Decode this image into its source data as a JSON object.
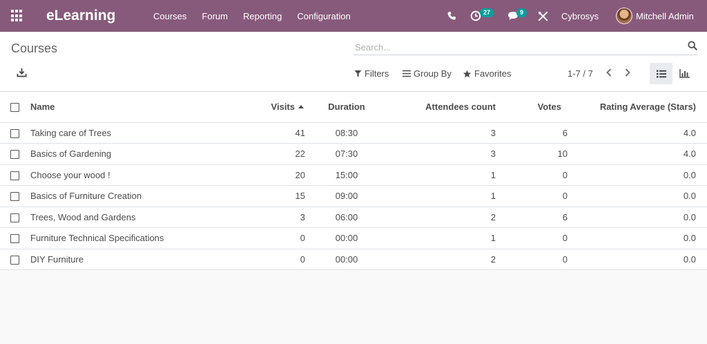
{
  "navbar": {
    "brand": "eLearning",
    "menu": [
      "Courses",
      "Forum",
      "Reporting",
      "Configuration"
    ],
    "activity_count": "27",
    "message_count": "9",
    "company": "Cybrosys",
    "user": "Mitchell Admin",
    "colors": {
      "bar": "#875a7b",
      "badge": "#00a09d"
    }
  },
  "control_panel": {
    "breadcrumb": "Courses",
    "search_placeholder": "Search...",
    "filters_label": "Filters",
    "groupby_label": "Group By",
    "favorites_label": "Favorites",
    "pager": "1-7 / 7",
    "active_view": "list"
  },
  "table": {
    "columns": [
      "Name",
      "Visits",
      "Duration",
      "Attendees count",
      "Votes",
      "Rating Average (Stars)"
    ],
    "sorted_by": "Visits",
    "rows": [
      {
        "name": "Taking care of Trees",
        "visits": "41",
        "duration": "08:30",
        "attendees": "3",
        "votes": "6",
        "rating": "4.0"
      },
      {
        "name": "Basics of Gardening",
        "visits": "22",
        "duration": "07:30",
        "attendees": "3",
        "votes": "10",
        "rating": "4.0"
      },
      {
        "name": "Choose your wood !",
        "visits": "20",
        "duration": "15:00",
        "attendees": "1",
        "votes": "0",
        "rating": "0.0"
      },
      {
        "name": "Basics of Furniture Creation",
        "visits": "15",
        "duration": "09:00",
        "attendees": "1",
        "votes": "0",
        "rating": "0.0"
      },
      {
        "name": "Trees, Wood and Gardens",
        "visits": "3",
        "duration": "06:00",
        "attendees": "2",
        "votes": "6",
        "rating": "0.0"
      },
      {
        "name": "Furniture Technical Specifications",
        "visits": "0",
        "duration": "00:00",
        "attendees": "1",
        "votes": "0",
        "rating": "0.0"
      },
      {
        "name": "DIY Furniture",
        "visits": "0",
        "duration": "00:00",
        "attendees": "2",
        "votes": "0",
        "rating": "0.0"
      }
    ]
  }
}
